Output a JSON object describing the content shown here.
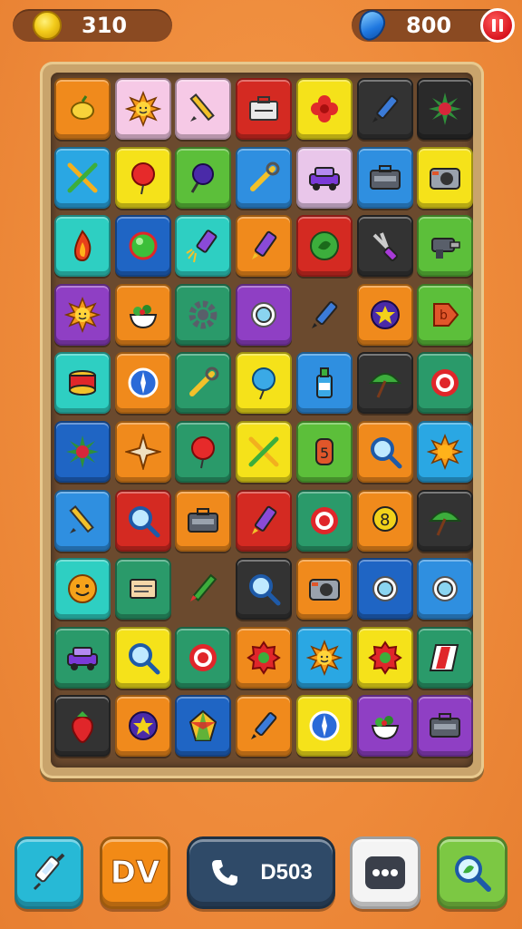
{
  "hud": {
    "coins": "310",
    "gems": "800"
  },
  "board": {
    "tiles": [
      {
        "color": "#f08a1c",
        "icon": "lemon-icon"
      },
      {
        "color": "#f6c9e6",
        "icon": "sun-face-icon"
      },
      {
        "color": "#f6c9e6",
        "icon": "pencil-icon"
      },
      {
        "color": "#d42a22",
        "icon": "toolbox-icon"
      },
      {
        "color": "#f5e21a",
        "icon": "red-flower-icon"
      },
      {
        "color": "#333333",
        "icon": "marker-icon"
      },
      {
        "color": "#2a2a2a",
        "icon": "spiky-berry-icon"
      },
      {
        "color": "#2aa7e3",
        "icon": "crossed-tools-icon"
      },
      {
        "color": "#f5e21a",
        "icon": "red-balloon-icon"
      },
      {
        "color": "#5cbf3a",
        "icon": "purple-pin-icon"
      },
      {
        "color": "#2f8fe0",
        "icon": "wrench-icon"
      },
      {
        "color": "#e9c6ea",
        "icon": "car-icon"
      },
      {
        "color": "#2f8fe0",
        "icon": "case-icon"
      },
      {
        "color": "#f5e21a",
        "icon": "camera-icon"
      },
      {
        "color": "#2ecfc2",
        "icon": "flame-icon"
      },
      {
        "color": "#1f65c4",
        "icon": "green-ball-icon"
      },
      {
        "color": "#2ecfc2",
        "icon": "firework-icon"
      },
      {
        "color": "#f08a1c",
        "icon": "purple-crayon-icon"
      },
      {
        "color": "#d42a22",
        "icon": "green-badge-icon"
      },
      {
        "color": "#333333",
        "icon": "wire-cutter-icon"
      },
      {
        "color": "#5cbf3a",
        "icon": "drill-icon"
      },
      {
        "color": "#8f3fc4",
        "icon": "sun-face-icon"
      },
      {
        "color": "#f08a1c",
        "icon": "salad-bowl-icon"
      },
      {
        "color": "#2a9a6a",
        "icon": "gear-icon"
      },
      {
        "color": "#8f3fc4",
        "icon": "ring-icon"
      },
      {
        "color": "empty",
        "icon": "marker-icon"
      },
      {
        "color": "#f08a1c",
        "icon": "star-orb-icon"
      },
      {
        "color": "#5cbf3a",
        "icon": "red-tag-icon"
      },
      {
        "color": "#2ecfc2",
        "icon": "drum-icon"
      },
      {
        "color": "#f08a1c",
        "icon": "compass-icon"
      },
      {
        "color": "#2a9a6a",
        "icon": "wrench-icon"
      },
      {
        "color": "#f5e21a",
        "icon": "blue-balloon-icon"
      },
      {
        "color": "#2f8fe0",
        "icon": "bottle-icon"
      },
      {
        "color": "#333333",
        "icon": "umbrella-icon"
      },
      {
        "color": "#2a9a6a",
        "icon": "target-ring-icon"
      },
      {
        "color": "#1f65c4",
        "icon": "spiky-berry-icon"
      },
      {
        "color": "#f08a1c",
        "icon": "star-shuriken-icon"
      },
      {
        "color": "#2a9a6a",
        "icon": "red-balloon-icon"
      },
      {
        "color": "#f5e21a",
        "icon": "crossed-tools-icon"
      },
      {
        "color": "#5cbf3a",
        "icon": "number-tag-icon"
      },
      {
        "color": "#f08a1c",
        "icon": "magnifier-icon"
      },
      {
        "color": "#2aa7e3",
        "icon": "sun-icon"
      },
      {
        "color": "#2f8fe0",
        "icon": "pencil-icon"
      },
      {
        "color": "#d42a22",
        "icon": "magnifier-icon"
      },
      {
        "color": "#f08a1c",
        "icon": "case-icon"
      },
      {
        "color": "#d42a22",
        "icon": "purple-crayon-icon"
      },
      {
        "color": "#2a9a6a",
        "icon": "target-ring-icon"
      },
      {
        "color": "#f08a1c",
        "icon": "number-orb-icon"
      },
      {
        "color": "#333333",
        "icon": "umbrella-icon"
      },
      {
        "color": "#2ecfc2",
        "icon": "smiley-icon"
      },
      {
        "color": "#2a9a6a",
        "icon": "note-card-icon"
      },
      {
        "color": "empty",
        "icon": "green-pencil-icon"
      },
      {
        "color": "#333333",
        "icon": "magnifier-icon"
      },
      {
        "color": "#f08a1c",
        "icon": "camera-icon"
      },
      {
        "color": "#1f65c4",
        "icon": "ring-icon"
      },
      {
        "color": "#2f8fe0",
        "icon": "ring-icon"
      },
      {
        "color": "#2a9a6a",
        "icon": "car-icon"
      },
      {
        "color": "#f5e21a",
        "icon": "magnifier-icon"
      },
      {
        "color": "#2a9a6a",
        "icon": "target-ring-icon"
      },
      {
        "color": "#f08a1c",
        "icon": "red-badge-icon"
      },
      {
        "color": "#2aa7e3",
        "icon": "sun-face-icon"
      },
      {
        "color": "#f5e21a",
        "icon": "red-badge-icon"
      },
      {
        "color": "#2a9a6a",
        "icon": "flag-icon"
      },
      {
        "color": "#333333",
        "icon": "strawberry-icon"
      },
      {
        "color": "#f08a1c",
        "icon": "star-orb-icon"
      },
      {
        "color": "#1f65c4",
        "icon": "crystal-icon"
      },
      {
        "color": "#f08a1c",
        "icon": "marker-icon"
      },
      {
        "color": "#f5e21a",
        "icon": "compass-icon"
      },
      {
        "color": "#8f3fc4",
        "icon": "salad-bowl-icon"
      },
      {
        "color": "#8f3fc4",
        "icon": "case-icon"
      }
    ]
  },
  "toolbar": {
    "syringe_icon": "syringe-icon",
    "dv_label": "DV",
    "call_icon": "phone-icon",
    "call_label": "D503",
    "chat_icon": "chat-bubble-icon",
    "search_icon": "magnifier-icon"
  }
}
